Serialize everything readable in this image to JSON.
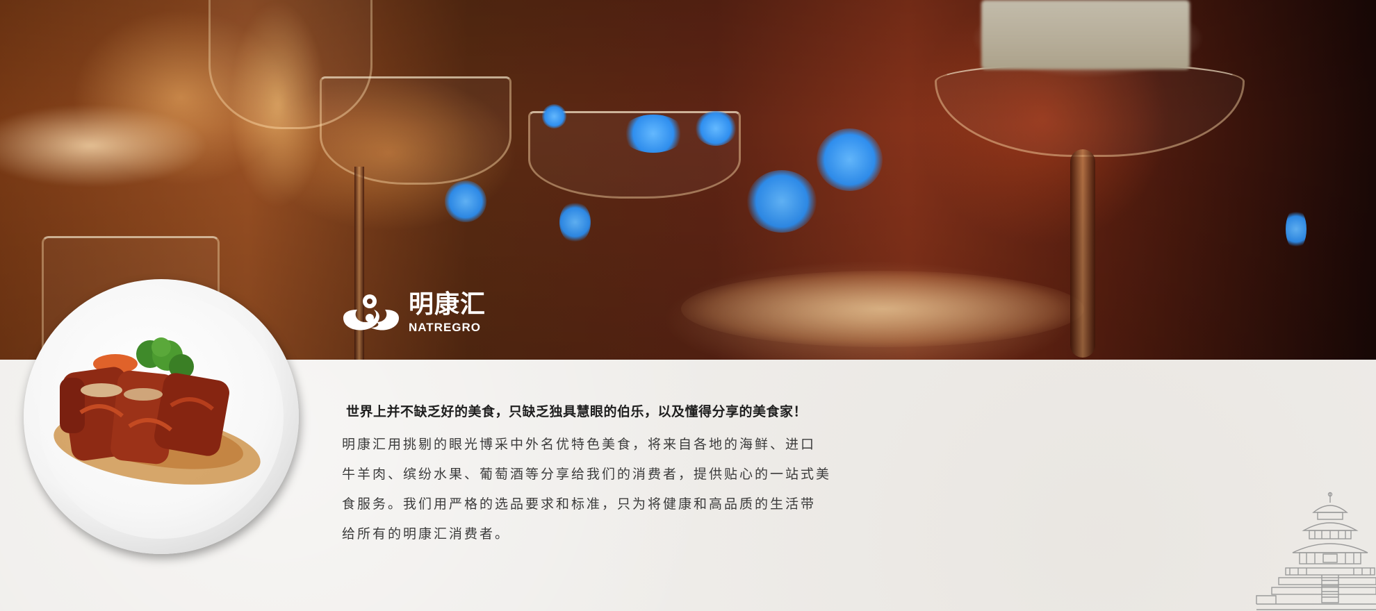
{
  "brand": {
    "name_cn": "明康汇",
    "name_en": "NATREGRO",
    "logo_icon": "swirl-logo-icon",
    "color": "#ffffff"
  },
  "hero": {
    "image": "restaurant-glasses-bokeh-photo"
  },
  "intro": {
    "title": "世界上并不缺乏好的美食，只缺乏独具慧眼的伯乐，以及懂得分享的美食家！",
    "lines": [
      "明康汇用挑剔的眼光博采中外名优特色美食，将来自各地的海鲜、进口",
      "牛羊肉、缤纷水果、葡萄酒等分享给我们的消费者，提供贴心的一站式美",
      "食服务。我们用严格的选品要求和标准，只为将健康和高品质的生活带",
      "给所有的明康汇消费者。"
    ]
  },
  "decor": {
    "plate_image": "short-ribs-plate-photo",
    "temple_icon": "temple-of-heaven-icon"
  },
  "colors": {
    "paper": "#efedea",
    "title_text": "#1e1e1e",
    "body_text": "#3b3b3b",
    "bokeh_blue": "#2f8ff0"
  }
}
